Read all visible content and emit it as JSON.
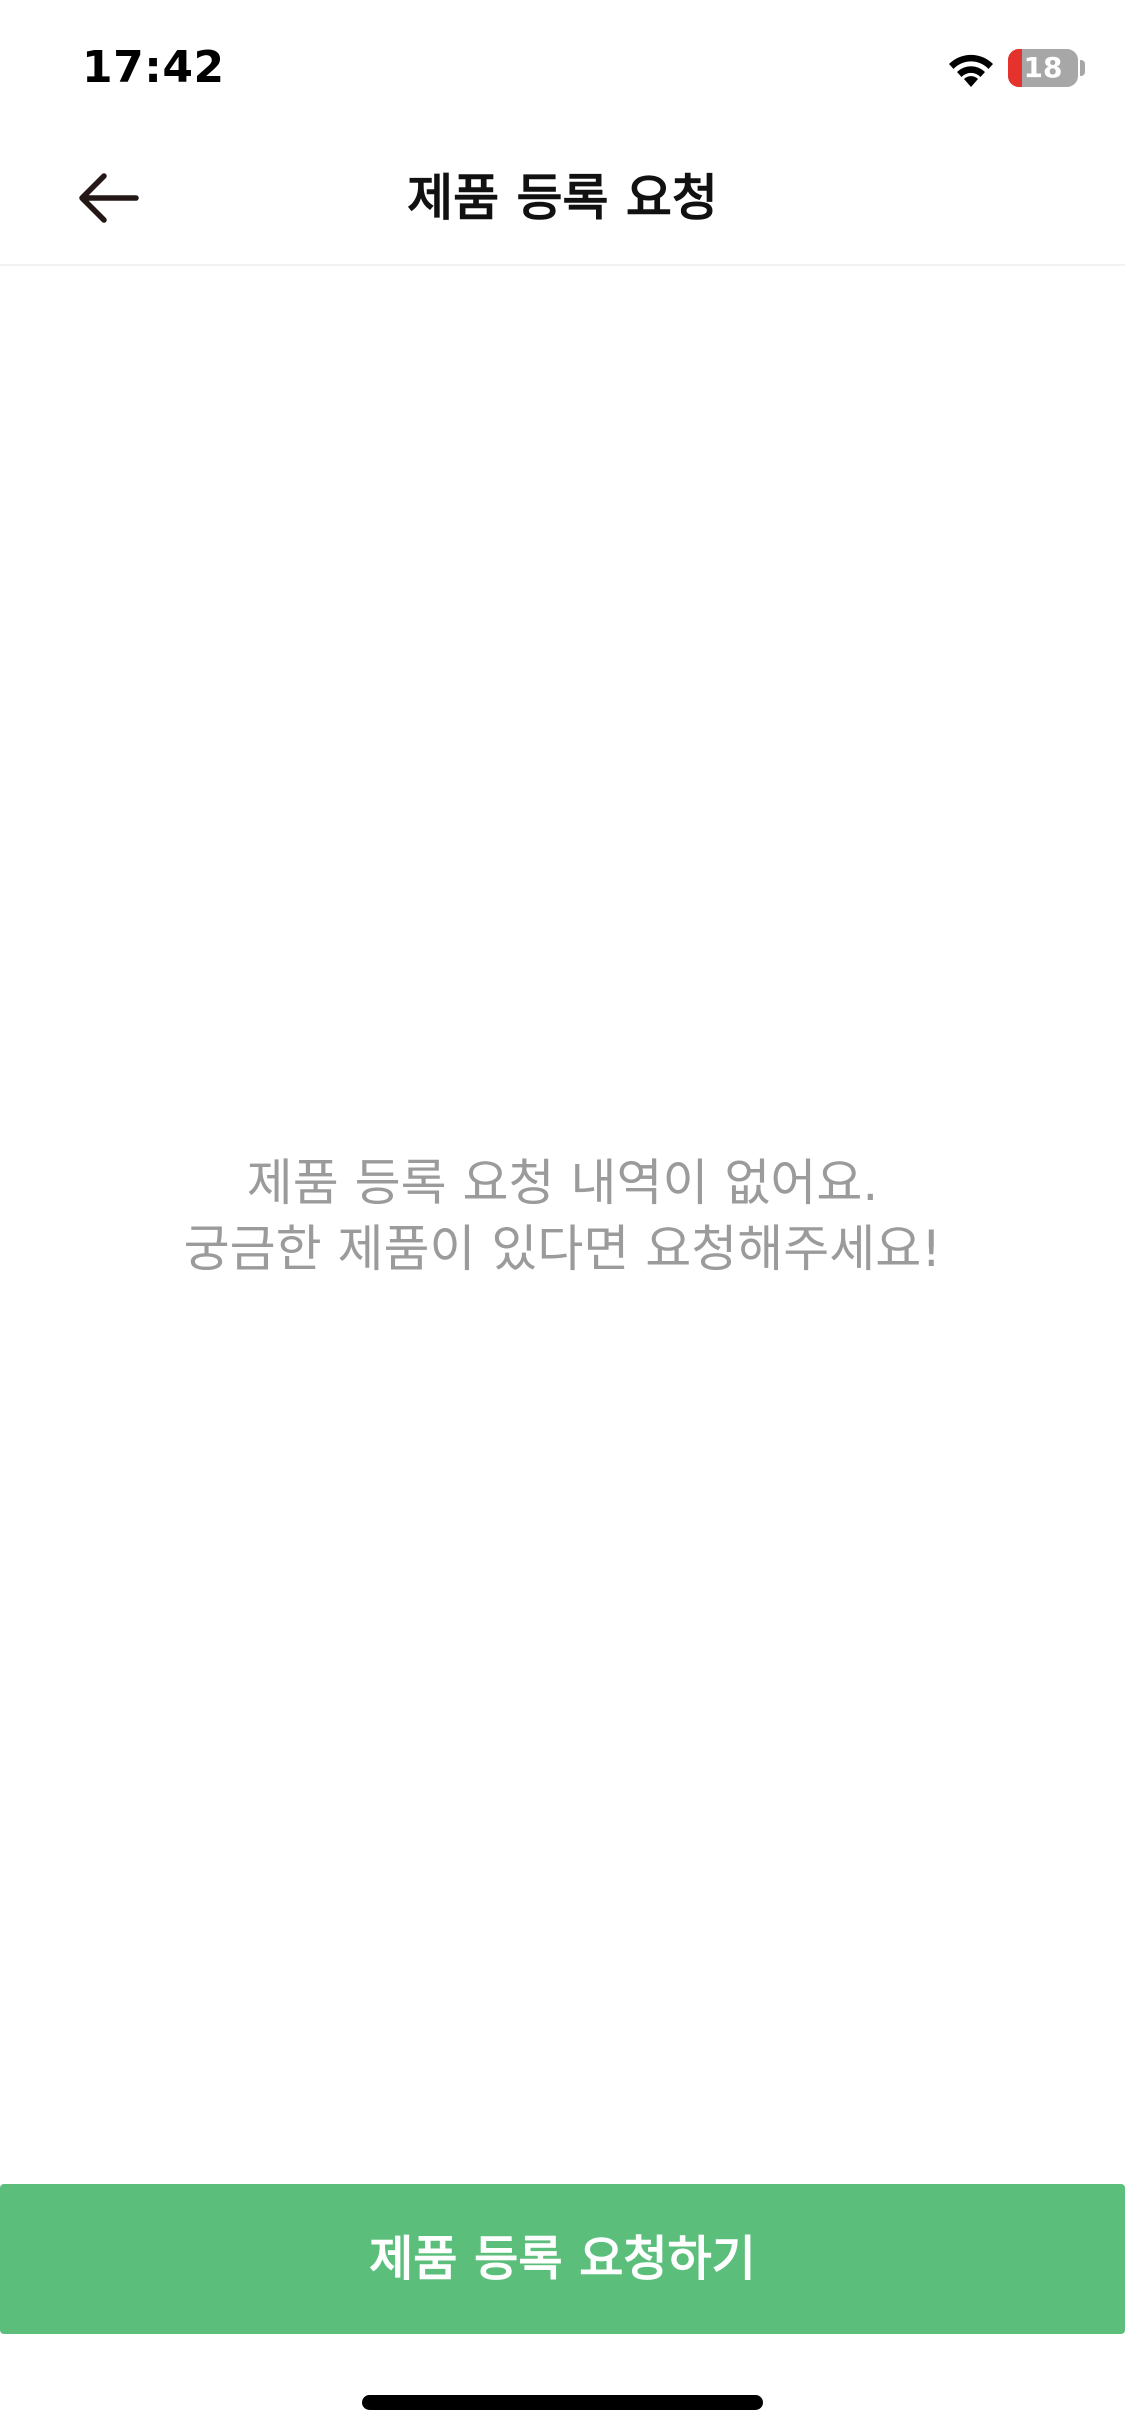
{
  "status_bar": {
    "time": "17:42",
    "battery_level": "18",
    "wifi_icon": "wifi-icon",
    "battery_low_color": "#e5322d"
  },
  "header": {
    "title": "제품 등록 요청",
    "back_icon": "arrow-left-icon"
  },
  "empty_state": {
    "line1": "제품 등록 요청 내역이 없어요.",
    "line2": "궁금한 제품이 있다면 요청해주세요!"
  },
  "cta": {
    "label": "제품 등록 요청하기",
    "color": "#5bbf7b"
  }
}
